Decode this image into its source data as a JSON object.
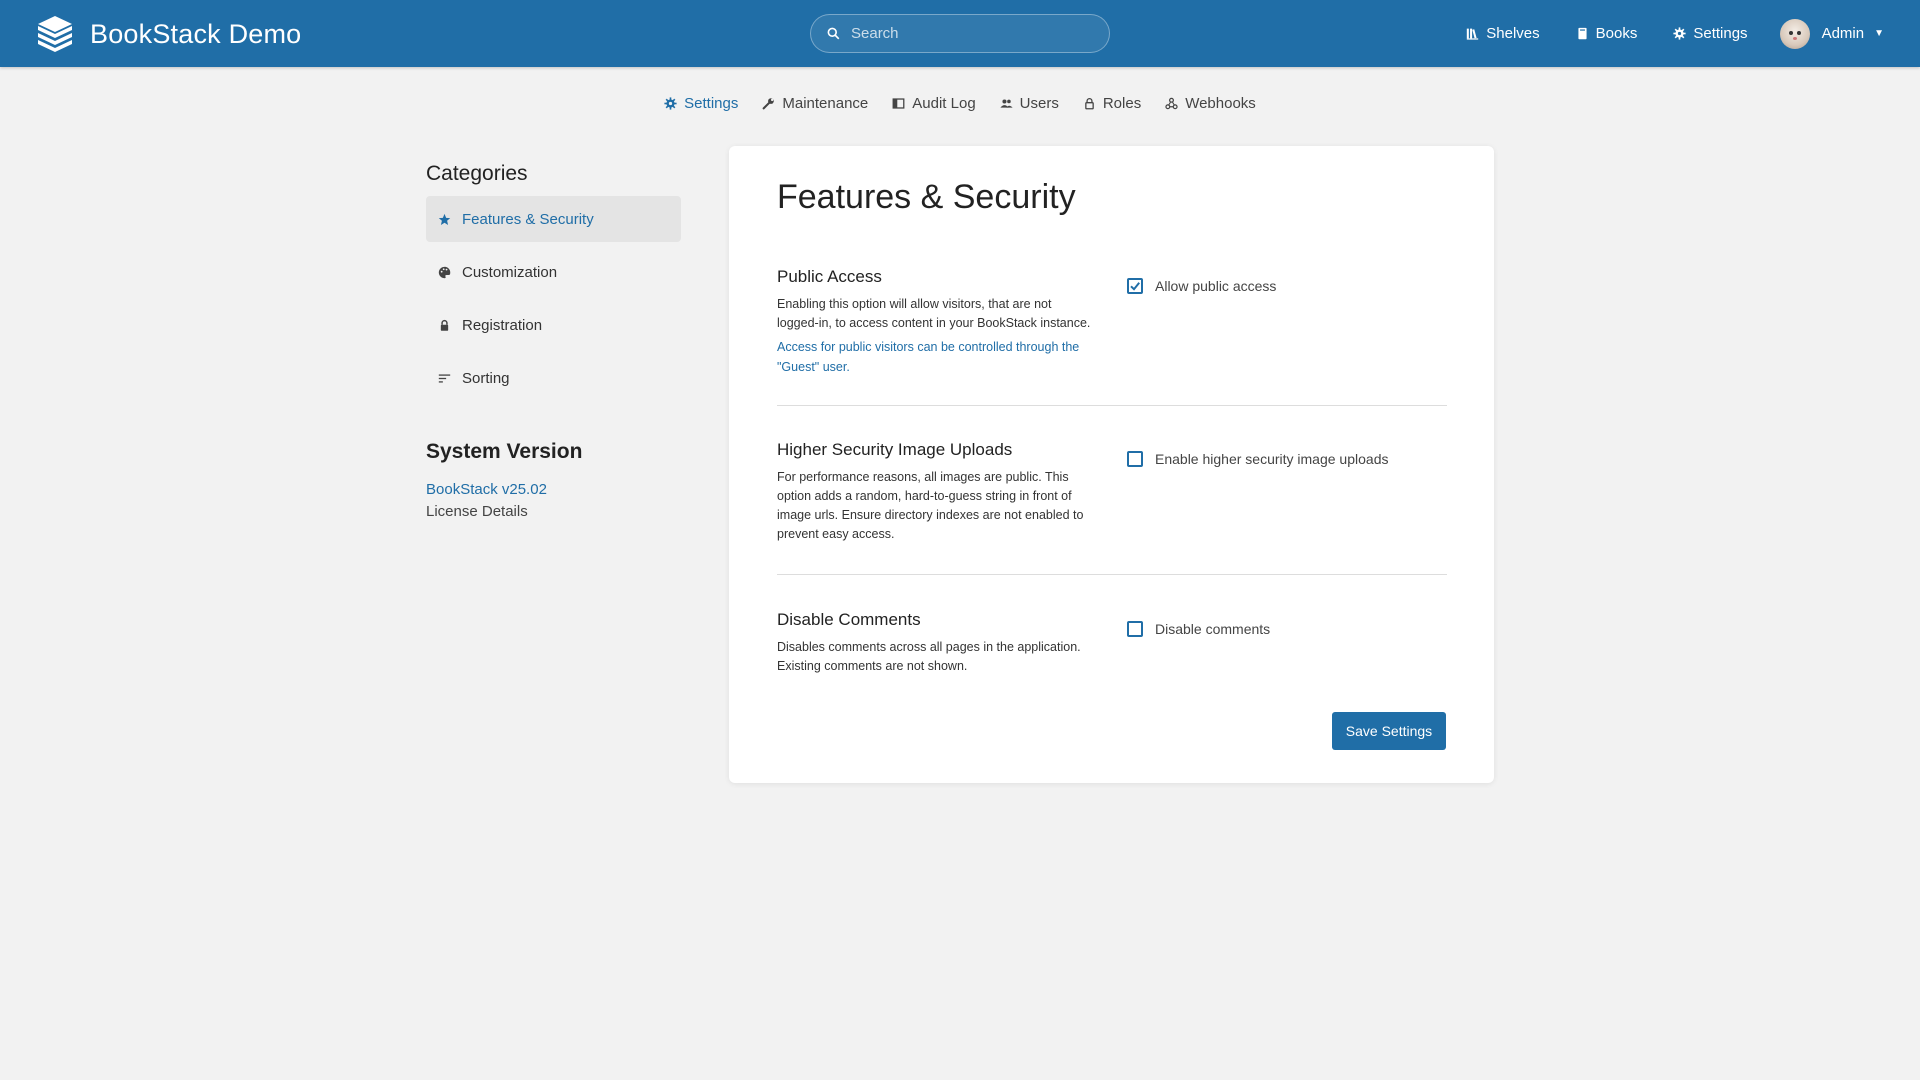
{
  "header": {
    "app_title": "BookStack Demo",
    "logo_icon": "books-stack-logo",
    "search": {
      "placeholder": "Search",
      "value": ""
    },
    "nav": [
      {
        "label": "Shelves",
        "icon": "bookshelf-icon"
      },
      {
        "label": "Books",
        "icon": "book-icon"
      },
      {
        "label": "Settings",
        "icon": "gear-icon"
      }
    ],
    "user": {
      "name": "Admin"
    },
    "colors": {
      "primary": "#206ea7"
    }
  },
  "settings_nav": [
    {
      "label": "Settings",
      "icon": "gear-icon",
      "active": true
    },
    {
      "label": "Maintenance",
      "icon": "wrench-icon",
      "active": false
    },
    {
      "label": "Audit Log",
      "icon": "audit-log-icon",
      "active": false
    },
    {
      "label": "Users",
      "icon": "users-icon",
      "active": false
    },
    {
      "label": "Roles",
      "icon": "lock-icon",
      "active": false
    },
    {
      "label": "Webhooks",
      "icon": "webhooks-icon",
      "active": false
    }
  ],
  "sidebar": {
    "heading": "Categories",
    "items": [
      {
        "label": "Features & Security",
        "icon": "star-icon",
        "active": true
      },
      {
        "label": "Customization",
        "icon": "palette-icon",
        "active": false
      },
      {
        "label": "Registration",
        "icon": "lock-icon",
        "active": false
      },
      {
        "label": "Sorting",
        "icon": "sort-icon",
        "active": false
      }
    ],
    "version_heading": "System Version",
    "version_link": "BookStack v25.02",
    "license_link": "License Details"
  },
  "main": {
    "title": "Features & Security",
    "settings": [
      {
        "label": "Public Access",
        "description": "Enabling this option will allow visitors, that are not logged-in, to access content in your BookStack instance.",
        "link": "Access for public visitors can be controlled through the \"Guest\" user.",
        "checkbox_label": "Allow public access",
        "checked": true
      },
      {
        "label": "Higher Security Image Uploads",
        "description": "For performance reasons, all images are public. This option adds a random, hard-to-guess string in front of image urls. Ensure directory indexes are not enabled to prevent easy access.",
        "checkbox_label": "Enable higher security image uploads",
        "checked": false
      },
      {
        "label": "Disable Comments",
        "description": "Disables comments across all pages in the application. Existing comments are not shown.",
        "checkbox_label": "Disable comments",
        "checked": false
      }
    ],
    "save_label": "Save Settings"
  }
}
